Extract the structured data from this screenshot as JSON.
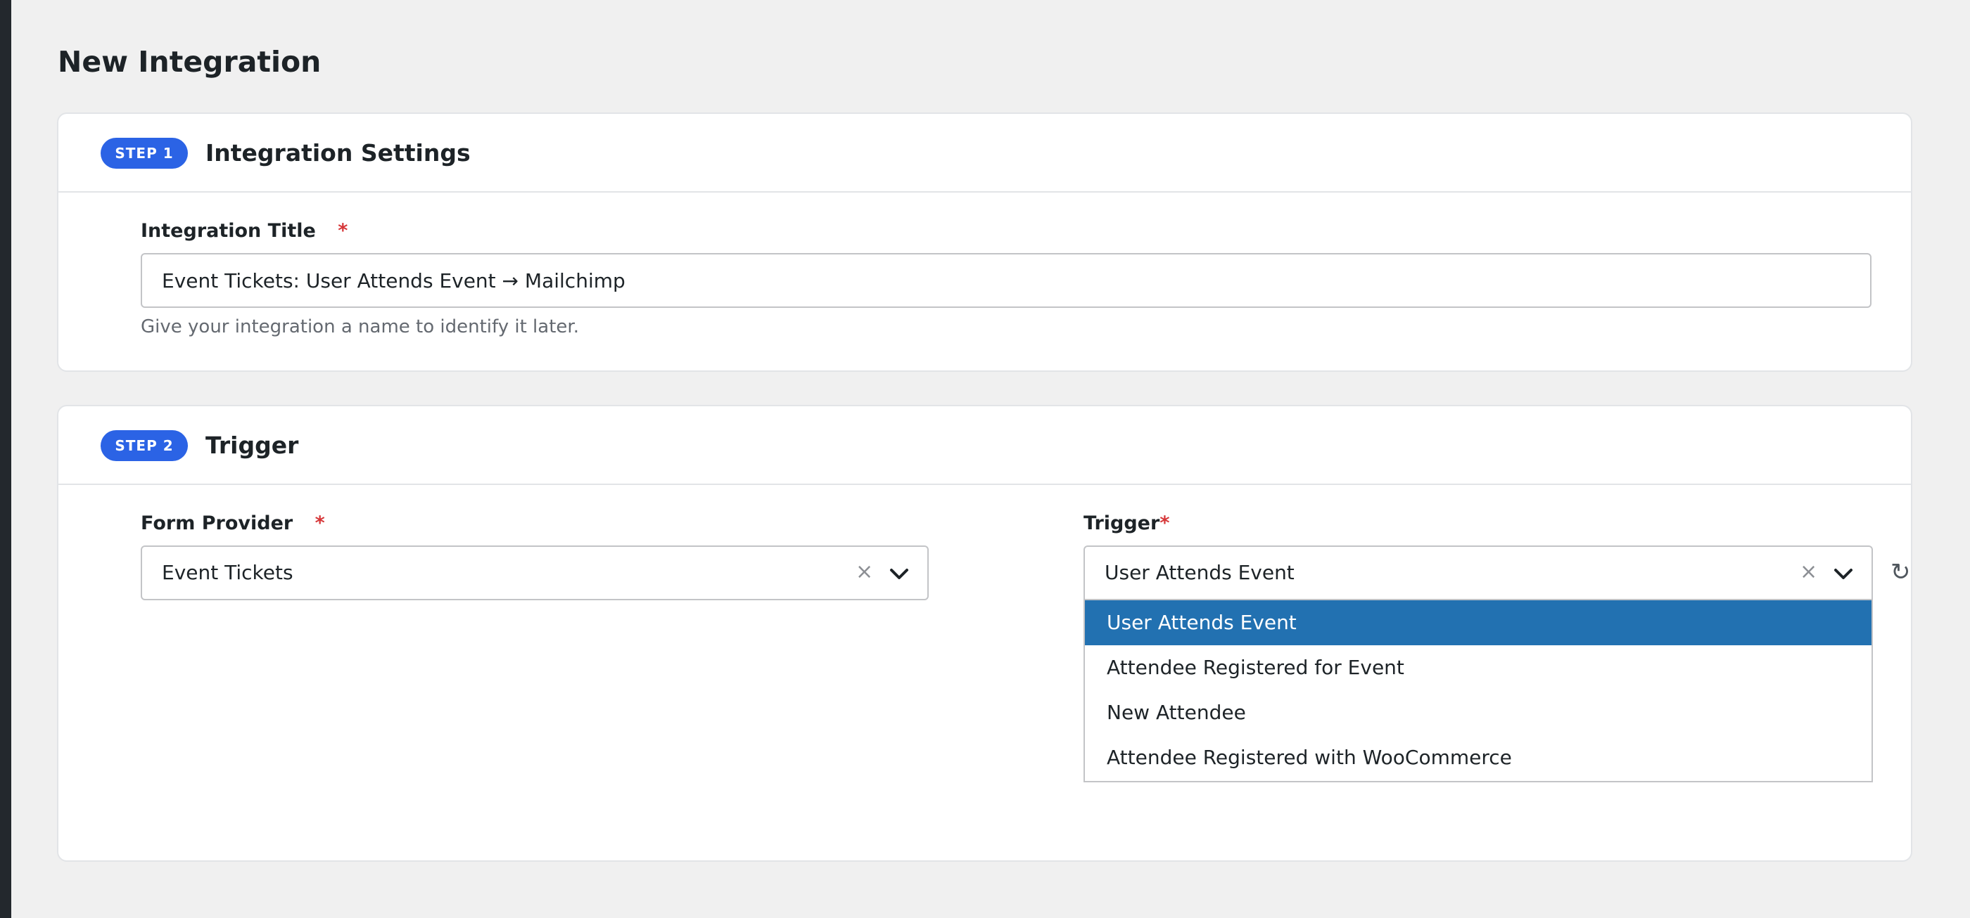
{
  "page": {
    "title": "New Integration"
  },
  "colors": {
    "step_badge": "#2b63e5",
    "required": "#d63638",
    "selected_option": "#2271b1",
    "background": "#f0f0f0"
  },
  "step1": {
    "badge": "STEP 1",
    "title": "Integration Settings",
    "integration_title": {
      "label": "Integration Title",
      "required_mark": "*",
      "value": "Event Tickets: User Attends Event → Mailchimp",
      "help": "Give your integration a name to identify it later."
    }
  },
  "step2": {
    "badge": "STEP 2",
    "title": "Trigger",
    "form_provider": {
      "label": "Form Provider",
      "required_mark": "*",
      "value": "Event Tickets",
      "clear_icon": "close-icon",
      "toggle_icon": "chevron-down-icon"
    },
    "trigger": {
      "label": "Trigger",
      "required_mark": "*",
      "value": "User Attends Event",
      "clear_icon": "close-icon",
      "toggle_icon": "chevron-down-icon",
      "refresh_icon": "refresh-icon",
      "open": true,
      "options": [
        {
          "label": "User Attends Event",
          "selected": true
        },
        {
          "label": "Attendee Registered for Event",
          "selected": false
        },
        {
          "label": "New Attendee",
          "selected": false
        },
        {
          "label": "Attendee Registered with WooCommerce",
          "selected": false
        }
      ]
    }
  }
}
